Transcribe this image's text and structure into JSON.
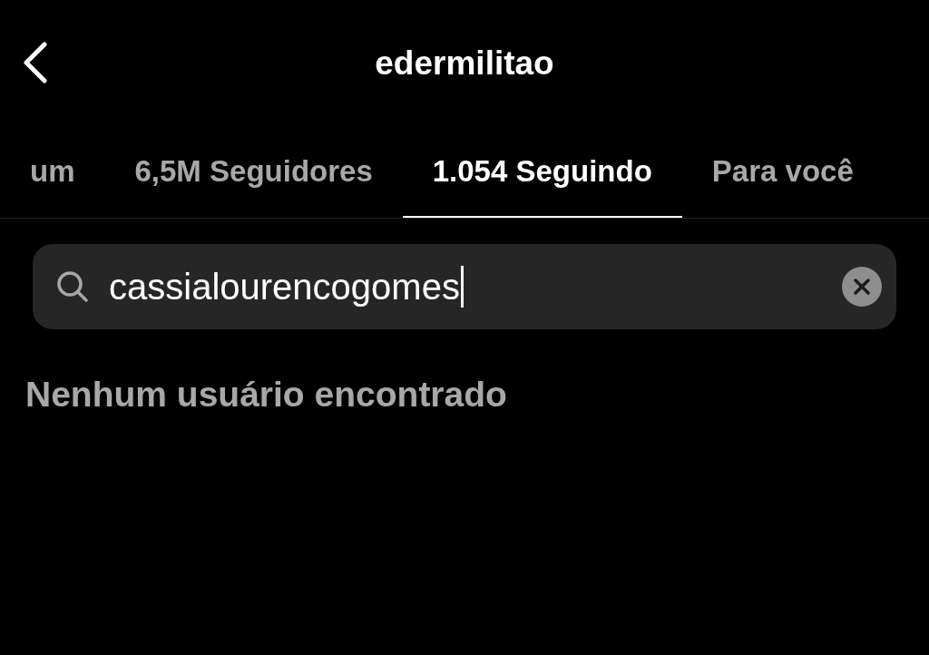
{
  "header": {
    "title": "edermilitao"
  },
  "tabs": [
    {
      "label": "um",
      "selected": false
    },
    {
      "label": "6,5M Seguidores",
      "selected": false
    },
    {
      "label": "1.054 Seguindo",
      "selected": true
    },
    {
      "label": "Para você",
      "selected": false
    }
  ],
  "search": {
    "value": "cassialourencogomes",
    "focused": true
  },
  "empty_message": "Nenhum usuário encontrado"
}
